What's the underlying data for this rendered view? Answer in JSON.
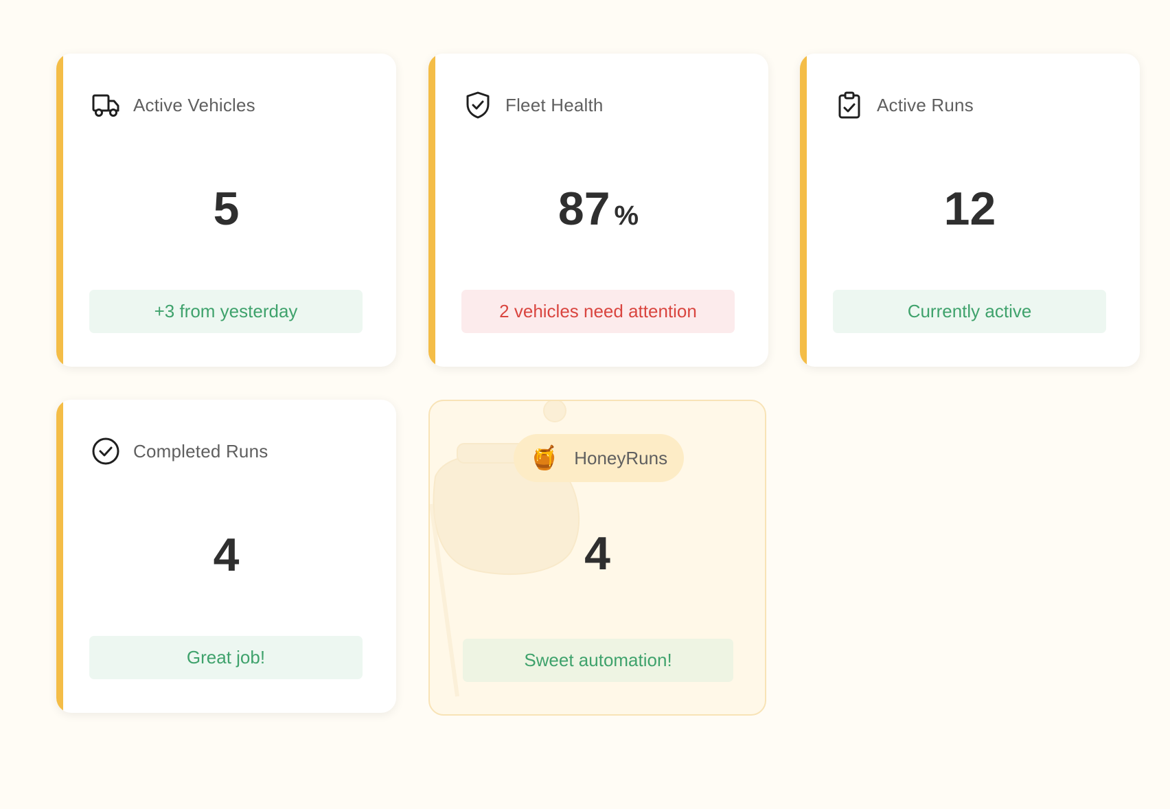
{
  "cards": [
    {
      "icon": "truck-icon",
      "label": "Active Vehicles",
      "value": "5",
      "unit": "",
      "status": "+3 from yesterday",
      "status_tone": "success"
    },
    {
      "icon": "shield-check-icon",
      "label": "Fleet Health",
      "value": "87",
      "unit": "%",
      "status": "2 vehicles need attention",
      "status_tone": "warning"
    },
    {
      "icon": "clipboard-check-icon",
      "label": "Active Runs",
      "value": "12",
      "unit": "",
      "status": "Currently active",
      "status_tone": "success"
    },
    {
      "icon": "check-circle-icon",
      "label": "Completed Runs",
      "value": "4",
      "unit": "",
      "status": "Great job!",
      "status_tone": "success"
    }
  ],
  "honey_card": {
    "icon": "honey-pot-icon",
    "emoji": "🍯",
    "label": "HoneyRuns",
    "value": "4",
    "status": "Sweet automation!"
  },
  "colors": {
    "page_background": "#fffcf5",
    "accent": "#f4bd47",
    "success_text": "#3fa26c",
    "success_background": "#edf7f1",
    "warning_text": "#d9453f",
    "warning_background": "#fcebec",
    "honey_background": "#fff8e8",
    "honey_border": "#f8e3b6"
  }
}
